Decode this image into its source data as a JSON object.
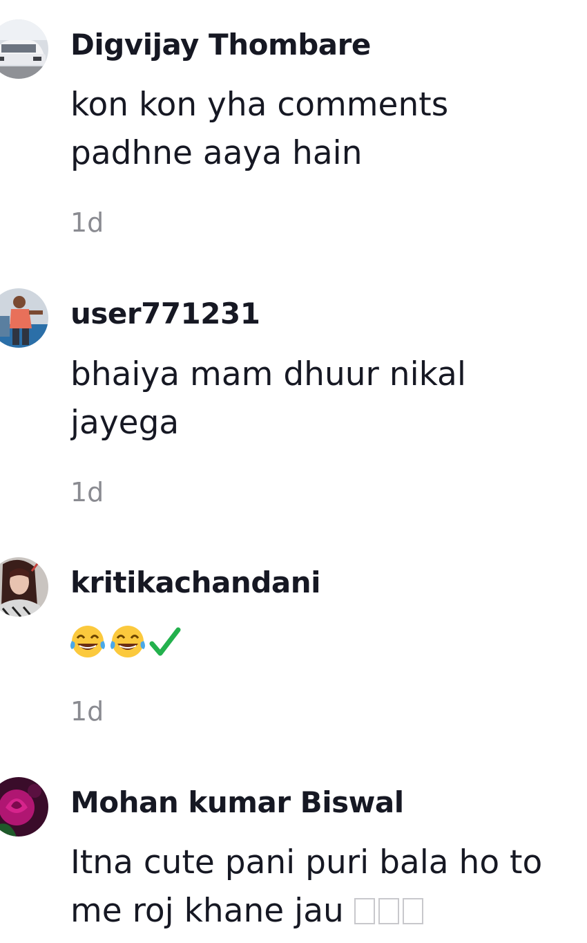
{
  "comments": [
    {
      "username": "Digvijay Thombare",
      "text": "kon kon yha comments\npadhne aaya hain",
      "time": "1d",
      "avatar": "car-photo-avatar"
    },
    {
      "username": "user771231",
      "text": "bhaiya mam dhuur nikal\njayega",
      "time": "1d",
      "avatar": "man-standing-photo-avatar"
    },
    {
      "username": "kritikachandani",
      "emojis": [
        "tears-of-joy-emoji",
        "tears-of-joy-emoji",
        "check-mark-icon"
      ],
      "time": "1d",
      "avatar": "woman-portrait-avatar"
    },
    {
      "username": "Mohan kumar Biswal",
      "text_line1": "Itna cute pani puri bala ho to",
      "text_line2": "me roj khane jau",
      "unrendered_glyphs": 3,
      "avatar": "rose-flower-avatar"
    }
  ]
}
